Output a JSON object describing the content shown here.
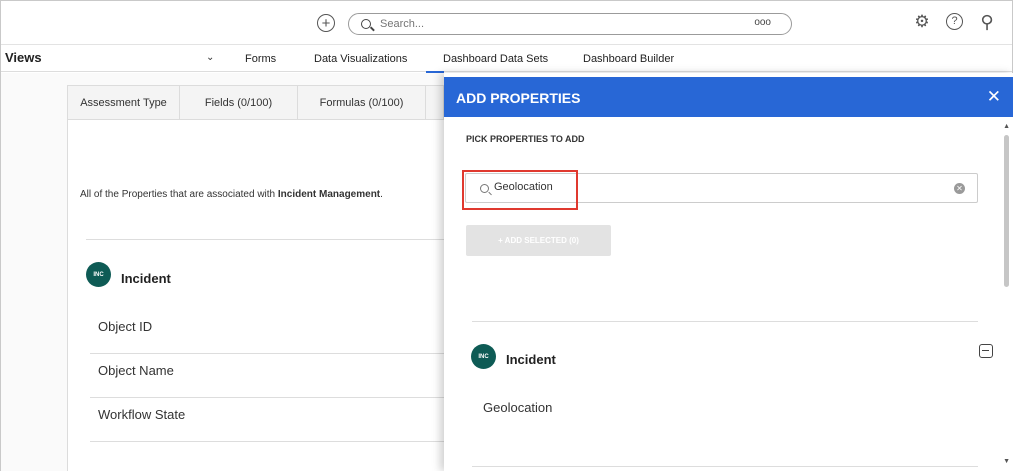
{
  "topbar": {
    "search_placeholder": "Search...",
    "more_dots": "ooo",
    "plus_glyph": "+",
    "settings_glyph": "⚙",
    "help_glyph": "?",
    "user_glyph": "⚲"
  },
  "nav": {
    "views_label": "Views",
    "chevron": "⌄",
    "items": [
      "Forms",
      "Data Visualizations",
      "Dashboard Data Sets",
      "Dashboard Builder"
    ]
  },
  "left": {
    "tabs": [
      "Assessment Type",
      "Fields (0/100)",
      "Formulas (0/100)"
    ],
    "description_prefix": "All of the Properties that are associated with ",
    "description_bold": "Incident Management",
    "description_suffix": ".",
    "object": {
      "badge": "INC",
      "title": "Incident"
    },
    "properties": [
      "Object ID",
      "Object Name",
      "Workflow State"
    ]
  },
  "panel": {
    "title": "ADD PROPERTIES",
    "close_glyph": "✕",
    "pick_label": "PICK PROPERTIES TO ADD",
    "filter_value": "Geolocation",
    "clear_glyph": "✕",
    "add_button": "+   ADD SELECTED (0)",
    "object": {
      "badge": "INC",
      "title": "Incident"
    },
    "properties": [
      "Geolocation"
    ]
  },
  "colors": {
    "header_blue": "#2867d6",
    "badge_teal": "#0e5b55",
    "highlight_red": "#e0392f"
  }
}
